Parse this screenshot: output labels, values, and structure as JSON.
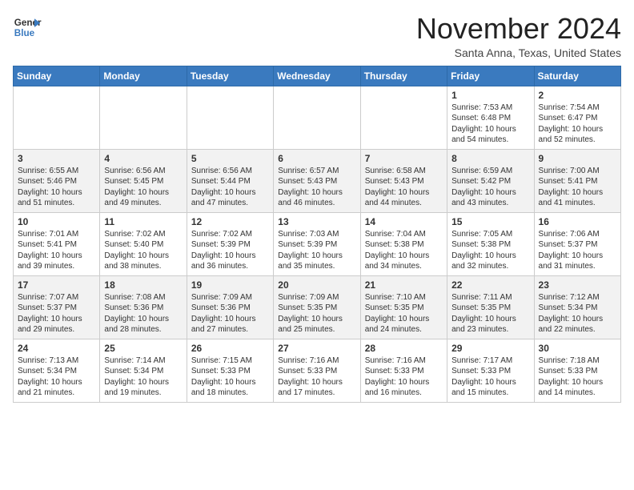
{
  "header": {
    "logo_line1": "General",
    "logo_line2": "Blue",
    "month": "November 2024",
    "location": "Santa Anna, Texas, United States"
  },
  "weekdays": [
    "Sunday",
    "Monday",
    "Tuesday",
    "Wednesday",
    "Thursday",
    "Friday",
    "Saturday"
  ],
  "weeks": [
    [
      {
        "day": "",
        "info": ""
      },
      {
        "day": "",
        "info": ""
      },
      {
        "day": "",
        "info": ""
      },
      {
        "day": "",
        "info": ""
      },
      {
        "day": "",
        "info": ""
      },
      {
        "day": "1",
        "info": "Sunrise: 7:53 AM\nSunset: 6:48 PM\nDaylight: 10 hours and 54 minutes."
      },
      {
        "day": "2",
        "info": "Sunrise: 7:54 AM\nSunset: 6:47 PM\nDaylight: 10 hours and 52 minutes."
      }
    ],
    [
      {
        "day": "3",
        "info": "Sunrise: 6:55 AM\nSunset: 5:46 PM\nDaylight: 10 hours and 51 minutes."
      },
      {
        "day": "4",
        "info": "Sunrise: 6:56 AM\nSunset: 5:45 PM\nDaylight: 10 hours and 49 minutes."
      },
      {
        "day": "5",
        "info": "Sunrise: 6:56 AM\nSunset: 5:44 PM\nDaylight: 10 hours and 47 minutes."
      },
      {
        "day": "6",
        "info": "Sunrise: 6:57 AM\nSunset: 5:43 PM\nDaylight: 10 hours and 46 minutes."
      },
      {
        "day": "7",
        "info": "Sunrise: 6:58 AM\nSunset: 5:43 PM\nDaylight: 10 hours and 44 minutes."
      },
      {
        "day": "8",
        "info": "Sunrise: 6:59 AM\nSunset: 5:42 PM\nDaylight: 10 hours and 43 minutes."
      },
      {
        "day": "9",
        "info": "Sunrise: 7:00 AM\nSunset: 5:41 PM\nDaylight: 10 hours and 41 minutes."
      }
    ],
    [
      {
        "day": "10",
        "info": "Sunrise: 7:01 AM\nSunset: 5:41 PM\nDaylight: 10 hours and 39 minutes."
      },
      {
        "day": "11",
        "info": "Sunrise: 7:02 AM\nSunset: 5:40 PM\nDaylight: 10 hours and 38 minutes."
      },
      {
        "day": "12",
        "info": "Sunrise: 7:02 AM\nSunset: 5:39 PM\nDaylight: 10 hours and 36 minutes."
      },
      {
        "day": "13",
        "info": "Sunrise: 7:03 AM\nSunset: 5:39 PM\nDaylight: 10 hours and 35 minutes."
      },
      {
        "day": "14",
        "info": "Sunrise: 7:04 AM\nSunset: 5:38 PM\nDaylight: 10 hours and 34 minutes."
      },
      {
        "day": "15",
        "info": "Sunrise: 7:05 AM\nSunset: 5:38 PM\nDaylight: 10 hours and 32 minutes."
      },
      {
        "day": "16",
        "info": "Sunrise: 7:06 AM\nSunset: 5:37 PM\nDaylight: 10 hours and 31 minutes."
      }
    ],
    [
      {
        "day": "17",
        "info": "Sunrise: 7:07 AM\nSunset: 5:37 PM\nDaylight: 10 hours and 29 minutes."
      },
      {
        "day": "18",
        "info": "Sunrise: 7:08 AM\nSunset: 5:36 PM\nDaylight: 10 hours and 28 minutes."
      },
      {
        "day": "19",
        "info": "Sunrise: 7:09 AM\nSunset: 5:36 PM\nDaylight: 10 hours and 27 minutes."
      },
      {
        "day": "20",
        "info": "Sunrise: 7:09 AM\nSunset: 5:35 PM\nDaylight: 10 hours and 25 minutes."
      },
      {
        "day": "21",
        "info": "Sunrise: 7:10 AM\nSunset: 5:35 PM\nDaylight: 10 hours and 24 minutes."
      },
      {
        "day": "22",
        "info": "Sunrise: 7:11 AM\nSunset: 5:35 PM\nDaylight: 10 hours and 23 minutes."
      },
      {
        "day": "23",
        "info": "Sunrise: 7:12 AM\nSunset: 5:34 PM\nDaylight: 10 hours and 22 minutes."
      }
    ],
    [
      {
        "day": "24",
        "info": "Sunrise: 7:13 AM\nSunset: 5:34 PM\nDaylight: 10 hours and 21 minutes."
      },
      {
        "day": "25",
        "info": "Sunrise: 7:14 AM\nSunset: 5:34 PM\nDaylight: 10 hours and 19 minutes."
      },
      {
        "day": "26",
        "info": "Sunrise: 7:15 AM\nSunset: 5:33 PM\nDaylight: 10 hours and 18 minutes."
      },
      {
        "day": "27",
        "info": "Sunrise: 7:16 AM\nSunset: 5:33 PM\nDaylight: 10 hours and 17 minutes."
      },
      {
        "day": "28",
        "info": "Sunrise: 7:16 AM\nSunset: 5:33 PM\nDaylight: 10 hours and 16 minutes."
      },
      {
        "day": "29",
        "info": "Sunrise: 7:17 AM\nSunset: 5:33 PM\nDaylight: 10 hours and 15 minutes."
      },
      {
        "day": "30",
        "info": "Sunrise: 7:18 AM\nSunset: 5:33 PM\nDaylight: 10 hours and 14 minutes."
      }
    ]
  ]
}
